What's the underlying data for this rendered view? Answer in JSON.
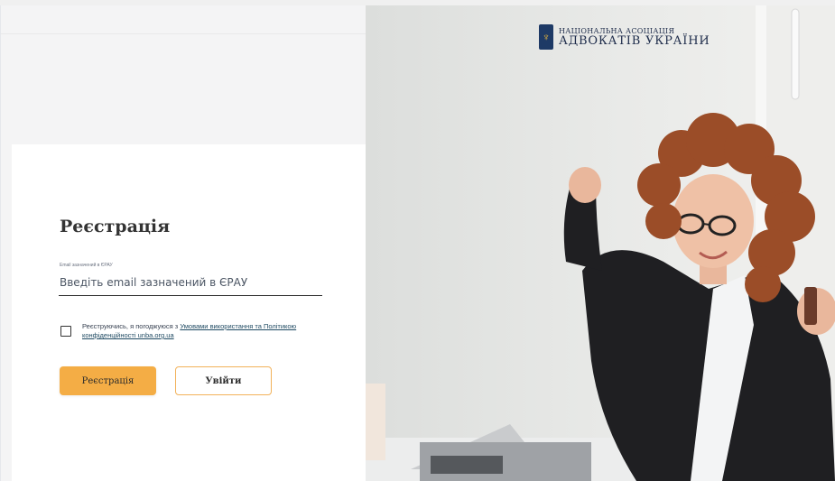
{
  "form": {
    "title": "Реєстрація",
    "email_label": "Email зазначений в ЄРАУ",
    "email_placeholder": "Введіть email зазначений в ЄРАУ",
    "email_value": "",
    "consent_text": "Реєструючись, я погоджуюся з ",
    "consent_link": "Умовами використання та Політикою конфіденційності unba.org.ua",
    "checkbox_checked": false,
    "register_button": "Реєстрація",
    "login_button": "Увійти"
  },
  "brand": {
    "line1": "НАЦІОНАЛЬНА АСОЦІАЦІЯ",
    "line2": "АДВОКАТІВ УКРАЇНИ",
    "emblem_icon": "trident-icon",
    "emblem_color": "#1e3a66",
    "accent_color": "#f4ad45"
  }
}
